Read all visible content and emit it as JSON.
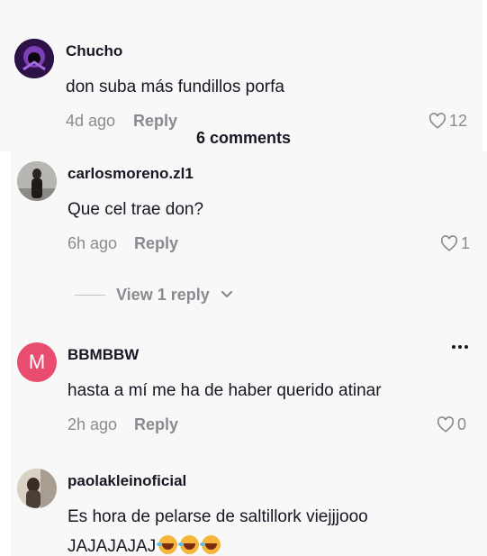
{
  "header": {
    "comment_count": "6 comments"
  },
  "reply_label": "Reply",
  "comments": [
    {
      "username": "Chucho",
      "text": "don suba más fundillos porfa",
      "time": "4d ago",
      "likes": "12",
      "avatar": "dark-purple-avatar"
    },
    {
      "username": "carlosmoreno.zl1",
      "text": "Que cel trae don?",
      "time": "6h ago",
      "likes": "1",
      "view_replies": "View 1 reply",
      "avatar": "person-photo-avatar"
    },
    {
      "username": "BBMBBW",
      "text": "hasta a mí me ha de haber querido atinar",
      "time": "2h ago",
      "likes": "0",
      "avatar_letter": "M",
      "avatar_color": "#e84d70"
    },
    {
      "username": "paolakleinoficial",
      "text_line1": "Es hora de pelarse de saltillork viejjjooo",
      "text_line2": "JAJAJAJAJ",
      "emoji": "rolling-on-floor-laughing",
      "avatar": "person-photo-avatar"
    }
  ],
  "colors": {
    "meta_gray": "#8a8b91",
    "background": "#f8f8f8",
    "text": "#161823"
  }
}
